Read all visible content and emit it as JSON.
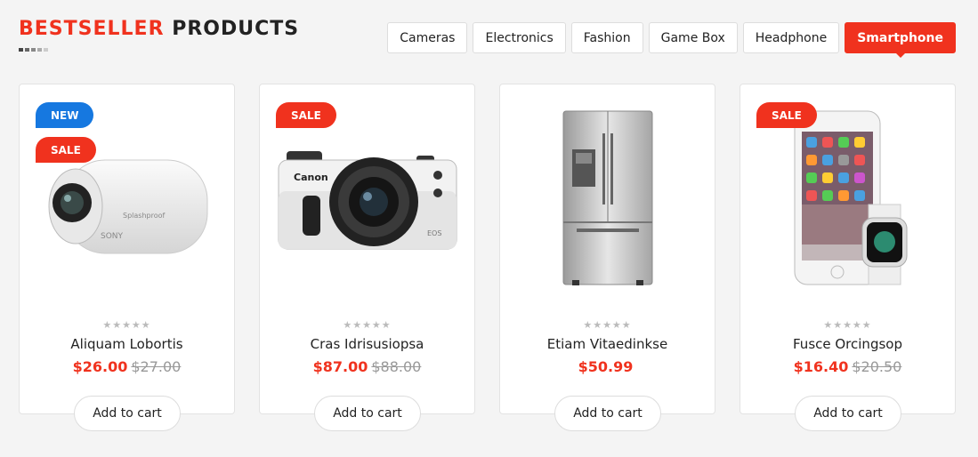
{
  "heading": {
    "accent": "BESTSELLER",
    "rest": "PRODUCTS"
  },
  "tabs": [
    {
      "label": "Cameras",
      "active": false
    },
    {
      "label": "Electronics",
      "active": false
    },
    {
      "label": "Fashion",
      "active": false
    },
    {
      "label": "Game Box",
      "active": false
    },
    {
      "label": "Headphone",
      "active": false
    },
    {
      "label": "Smartphone",
      "active": true
    }
  ],
  "products": [
    {
      "name": "Aliquam Lobortis",
      "price": "$26.00",
      "old_price": "$27.00",
      "badges": [
        "NEW",
        "SALE"
      ],
      "image": "action-camera",
      "stars": "★★★★★",
      "cart_label": "Add to cart"
    },
    {
      "name": "Cras Idrisusiopsa",
      "price": "$87.00",
      "old_price": "$88.00",
      "badges": [
        "SALE"
      ],
      "image": "dslr-camera",
      "stars": "★★★★★",
      "cart_label": "Add to cart"
    },
    {
      "name": "Etiam Vitaedinkse",
      "price": "$50.99",
      "old_price": "",
      "badges": [],
      "image": "refrigerator",
      "stars": "★★★★★",
      "cart_label": "Add to cart"
    },
    {
      "name": "Fusce Orcingsop",
      "price": "$16.40",
      "old_price": "$20.50",
      "badges": [
        "SALE"
      ],
      "image": "smartphone-watch",
      "stars": "★★★★★",
      "cart_label": "Add to cart"
    }
  ],
  "colors": {
    "accent": "#f0321e",
    "new_badge": "#1678e0",
    "dot_active": "#444444",
    "dot_inactive": "#cccccc"
  }
}
